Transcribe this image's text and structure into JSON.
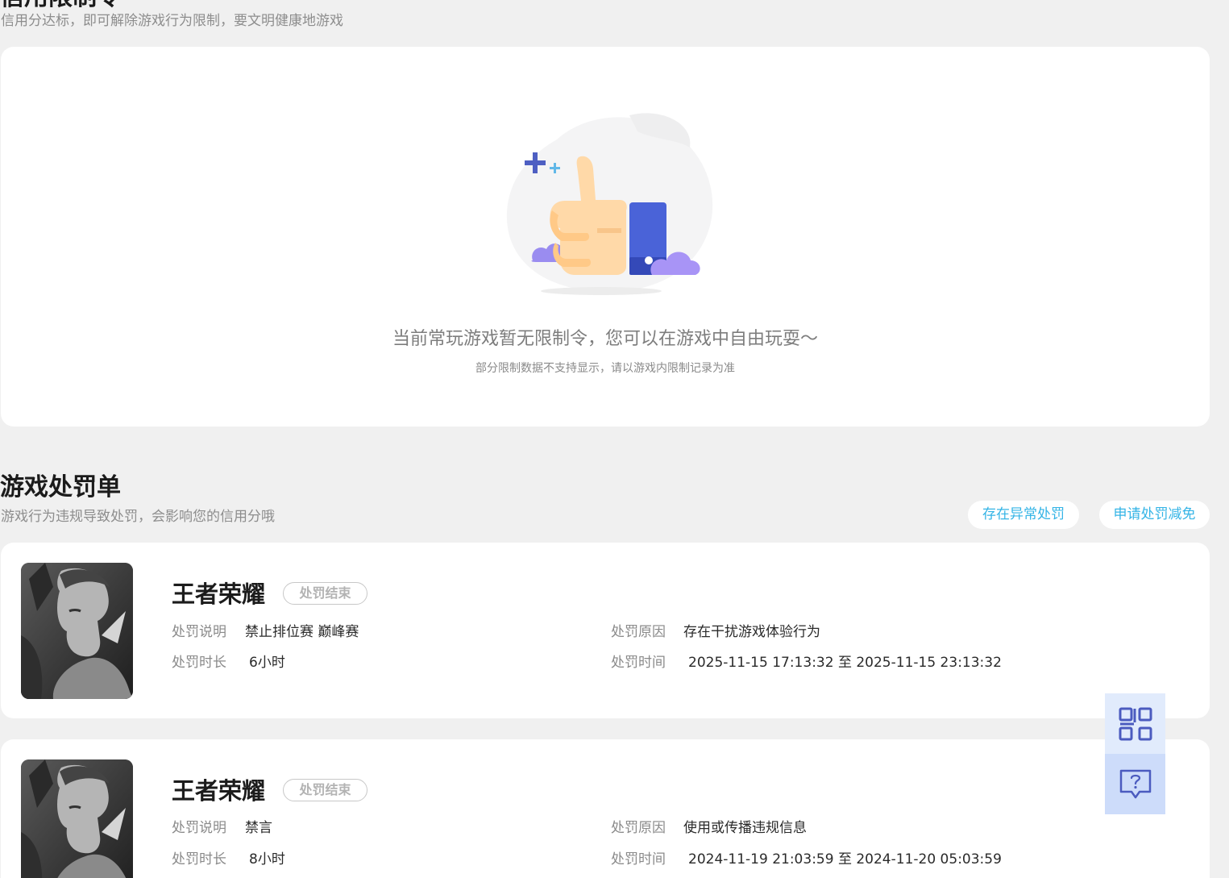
{
  "credit_section": {
    "title": "信用限制令",
    "subtitle": "信用分达标，即可解除游戏行为限制，要文明健康地游戏",
    "empty_state": {
      "illustration": "thumbs-up-illustration",
      "title": "当前常玩游戏暂无限制令，您可以在游戏中自由玩耍～",
      "note": "部分限制数据不支持显示，请以游戏内限制记录为准"
    }
  },
  "penalty_section": {
    "title": "游戏处罚单",
    "subtitle": "游戏行为违规导致处罚，会影响您的信用分哦",
    "actions": {
      "abnormal_label": "存在异常处罚",
      "appeal_label": "申请处罚减免"
    },
    "labels": {
      "description": "处罚说明",
      "reason": "处罚原因",
      "duration": "处罚时长",
      "time": "处罚时间"
    },
    "items": [
      {
        "game": "王者荣耀",
        "status": "处罚结束",
        "description": "禁止排位赛 巅峰赛",
        "reason": "存在干扰游戏体验行为",
        "duration": "6小时",
        "time": "2025-11-15 17:13:32 至 2025-11-15 23:13:32"
      },
      {
        "game": "王者荣耀",
        "status": "处罚结束",
        "description": "禁言",
        "reason": "使用或传播违规信息",
        "duration": "8小时",
        "time": "2024-11-19 21:03:59 至 2024-11-20 05:03:59"
      }
    ]
  },
  "floating_tools": {
    "qr_icon": "qr-code-icon",
    "feedback_icon": "feedback-question-icon"
  },
  "colors": {
    "page_bg": "#f0f0f0",
    "card_bg": "#ffffff",
    "accent": "#34b4e6",
    "float_bar": "#dde8fb"
  }
}
